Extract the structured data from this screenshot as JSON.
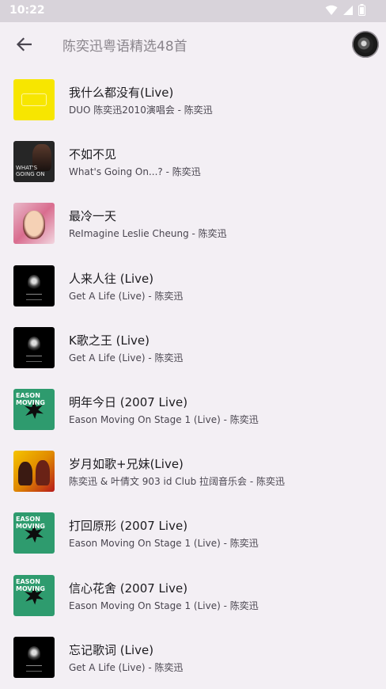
{
  "status_bar": {
    "time": "10:22",
    "icons": [
      "wifi-icon",
      "signal-icon",
      "battery-icon"
    ]
  },
  "app_bar": {
    "back_icon": "arrow-back-icon",
    "title": "陈奕迅粤语精选48首"
  },
  "songs": [
    {
      "title": "我什么都没有(Live)",
      "subtitle": "DUO 陈奕迅2010演唱会 - 陈奕迅",
      "cover": "duo"
    },
    {
      "title": "不如不见",
      "subtitle": "What's Going On...? - 陈奕迅",
      "cover": "whats"
    },
    {
      "title": "最冷一天",
      "subtitle": "ReImagine Leslie Cheung - 陈奕迅",
      "cover": "reimagine"
    },
    {
      "title": "人来人往 (Live)",
      "subtitle": "Get A Life (Live) - 陈奕迅",
      "cover": "life"
    },
    {
      "title": "K歌之王 (Live)",
      "subtitle": "Get A Life (Live) - 陈奕迅",
      "cover": "life"
    },
    {
      "title": "明年今日 (2007 Live)",
      "subtitle": "Eason Moving On Stage 1 (Live) - 陈奕迅",
      "cover": "eason"
    },
    {
      "title": "岁月如歌+兄妹(Live)",
      "subtitle": "陈奕迅 & 叶倩文 903 id Club 拉阔音乐会 - 陈奕迅",
      "cover": "903"
    },
    {
      "title": "打回原形 (2007 Live)",
      "subtitle": "Eason Moving On Stage 1 (Live) - 陈奕迅",
      "cover": "eason"
    },
    {
      "title": "信心花舍 (2007 Live)",
      "subtitle": "Eason Moving On Stage 1 (Live) - 陈奕迅",
      "cover": "eason"
    },
    {
      "title": "忘记歌词 (Live)",
      "subtitle": "Get A Life (Live) - 陈奕迅",
      "cover": "life"
    }
  ]
}
